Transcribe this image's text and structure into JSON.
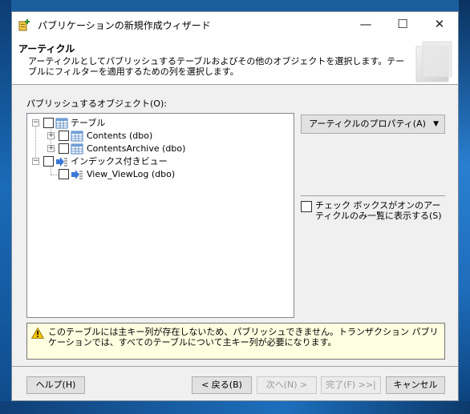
{
  "window": {
    "title": "パブリケーションの新規作成ウィザード"
  },
  "title_buttons": {
    "minimize": "—",
    "maximize": "☐",
    "close": "✕"
  },
  "header": {
    "title": "アーティクル",
    "description": "アーティクルとしてパブリッシュするテーブルおよびその他のオブジェクトを選択します。テーブルにフィルターを適用するための列を選択します。"
  },
  "objects_label": "パブリッシュするオブジェクト(O):",
  "tree": {
    "nodes": [
      {
        "label": "テーブル",
        "level": 0,
        "expanded": true,
        "checked": false,
        "icon": "table-icon"
      },
      {
        "label": "Contents (dbo)",
        "level": 1,
        "expanded": false,
        "checked": false,
        "icon": "table-icon"
      },
      {
        "label": "ContentsArchive (dbo)",
        "level": 1,
        "expanded": false,
        "checked": false,
        "icon": "table-icon"
      },
      {
        "label": "インデックス付きビュー",
        "level": 0,
        "expanded": true,
        "checked": false,
        "icon": "view-icon"
      },
      {
        "label": "View_ViewLog (dbo)",
        "level": 1,
        "expanded": null,
        "checked": false,
        "icon": "view-icon"
      }
    ]
  },
  "article_properties_button": "アーティクルのプロパティ(A)",
  "show_checked_only": {
    "label": "チェック ボックスがオンのアーティクルのみ一覧に表示する(S)",
    "checked": false
  },
  "warning": {
    "text": "このテーブルには主キー列が存在しないため、パブリッシュできません。トランザクション パブリケーションでは、すべてのテーブルについて主キー列が必要になります。",
    "icon": "warning-icon"
  },
  "footer": {
    "help": "ヘルプ(H)",
    "back": "< 戻る(B)",
    "next": "次へ(N) >",
    "finish": "完了(F) >>|",
    "cancel": "キャンセル"
  },
  "colors": {
    "warning_bg": "#ffffe1",
    "window_bg": "#f0f0f0",
    "desktop": "#1b5e9e"
  }
}
